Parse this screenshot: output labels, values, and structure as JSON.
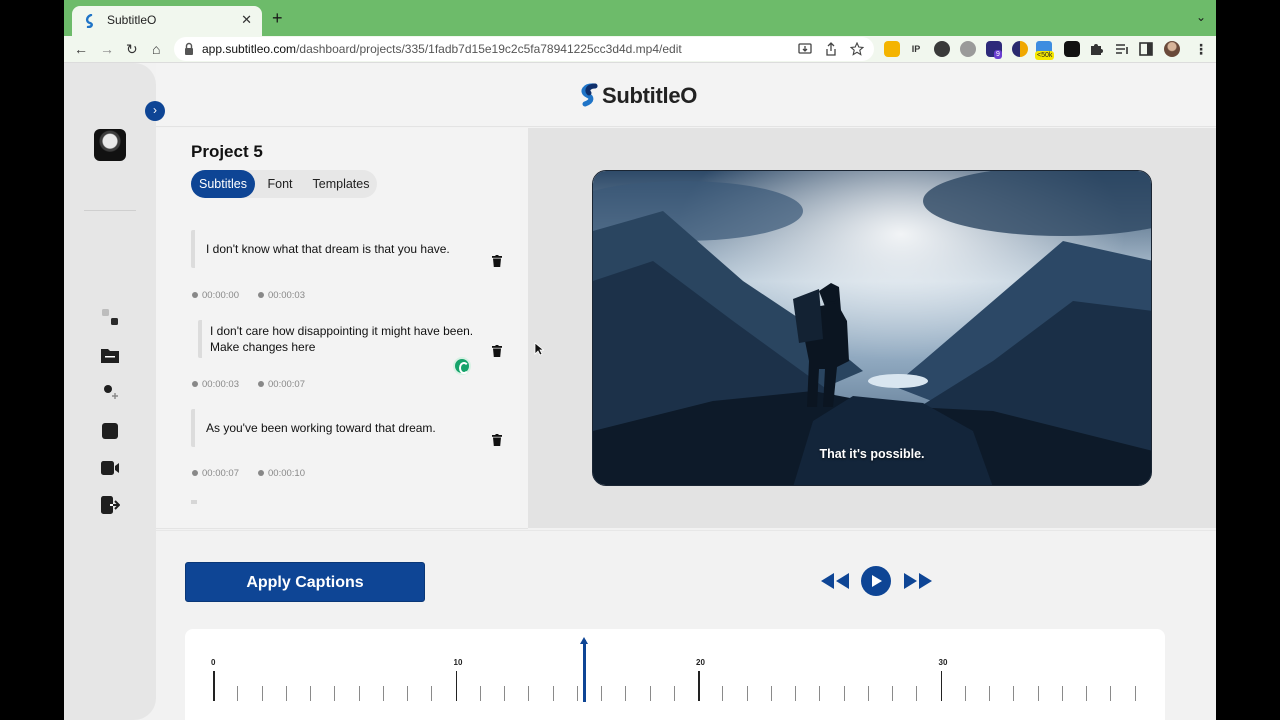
{
  "browser": {
    "tab_title": "SubtitleO",
    "tab_close": "✕",
    "new_tab": "+",
    "tab_menu": "⌄",
    "back": "←",
    "forward": "→",
    "reload": "↻",
    "home": "⌂",
    "url_domain": "app.subtitleo.com",
    "url_path": "/dashboard/projects/335/1fadb7d15e19c2c5fa78941225cc3d4d.mp4/edit",
    "extensions": {
      "badge_count": "9",
      "badge_50k": "<50k",
      "ip_label": "IP"
    },
    "menu": "⋮"
  },
  "app": {
    "logo_text": "SubtitleO",
    "collapse_icon": "›",
    "colors": {
      "primary": "#0e4595",
      "accent_green": "#15a36a"
    }
  },
  "project": {
    "title": "Project 5",
    "tabs": [
      {
        "label": "Subtitles",
        "active": true
      },
      {
        "label": "Font",
        "active": false
      },
      {
        "label": "Templates",
        "active": false
      }
    ]
  },
  "subtitles": [
    {
      "text": "I don't know what that dream is that you have.",
      "start": "00:00:00",
      "end": "00:00:03"
    },
    {
      "text": "I don't care how disappointing it might have been. Make changes here",
      "start": "00:00:03",
      "end": "00:00:07"
    },
    {
      "text": "As you've been working toward that dream.",
      "start": "00:00:07",
      "end": "00:00:10"
    }
  ],
  "video": {
    "caption": "That it's possible."
  },
  "controls": {
    "apply_label": "Apply Captions"
  },
  "timeline": {
    "labels": [
      "0",
      "10",
      "20",
      "30"
    ],
    "playhead_seconds": 15.3,
    "max_seconds": 38
  }
}
